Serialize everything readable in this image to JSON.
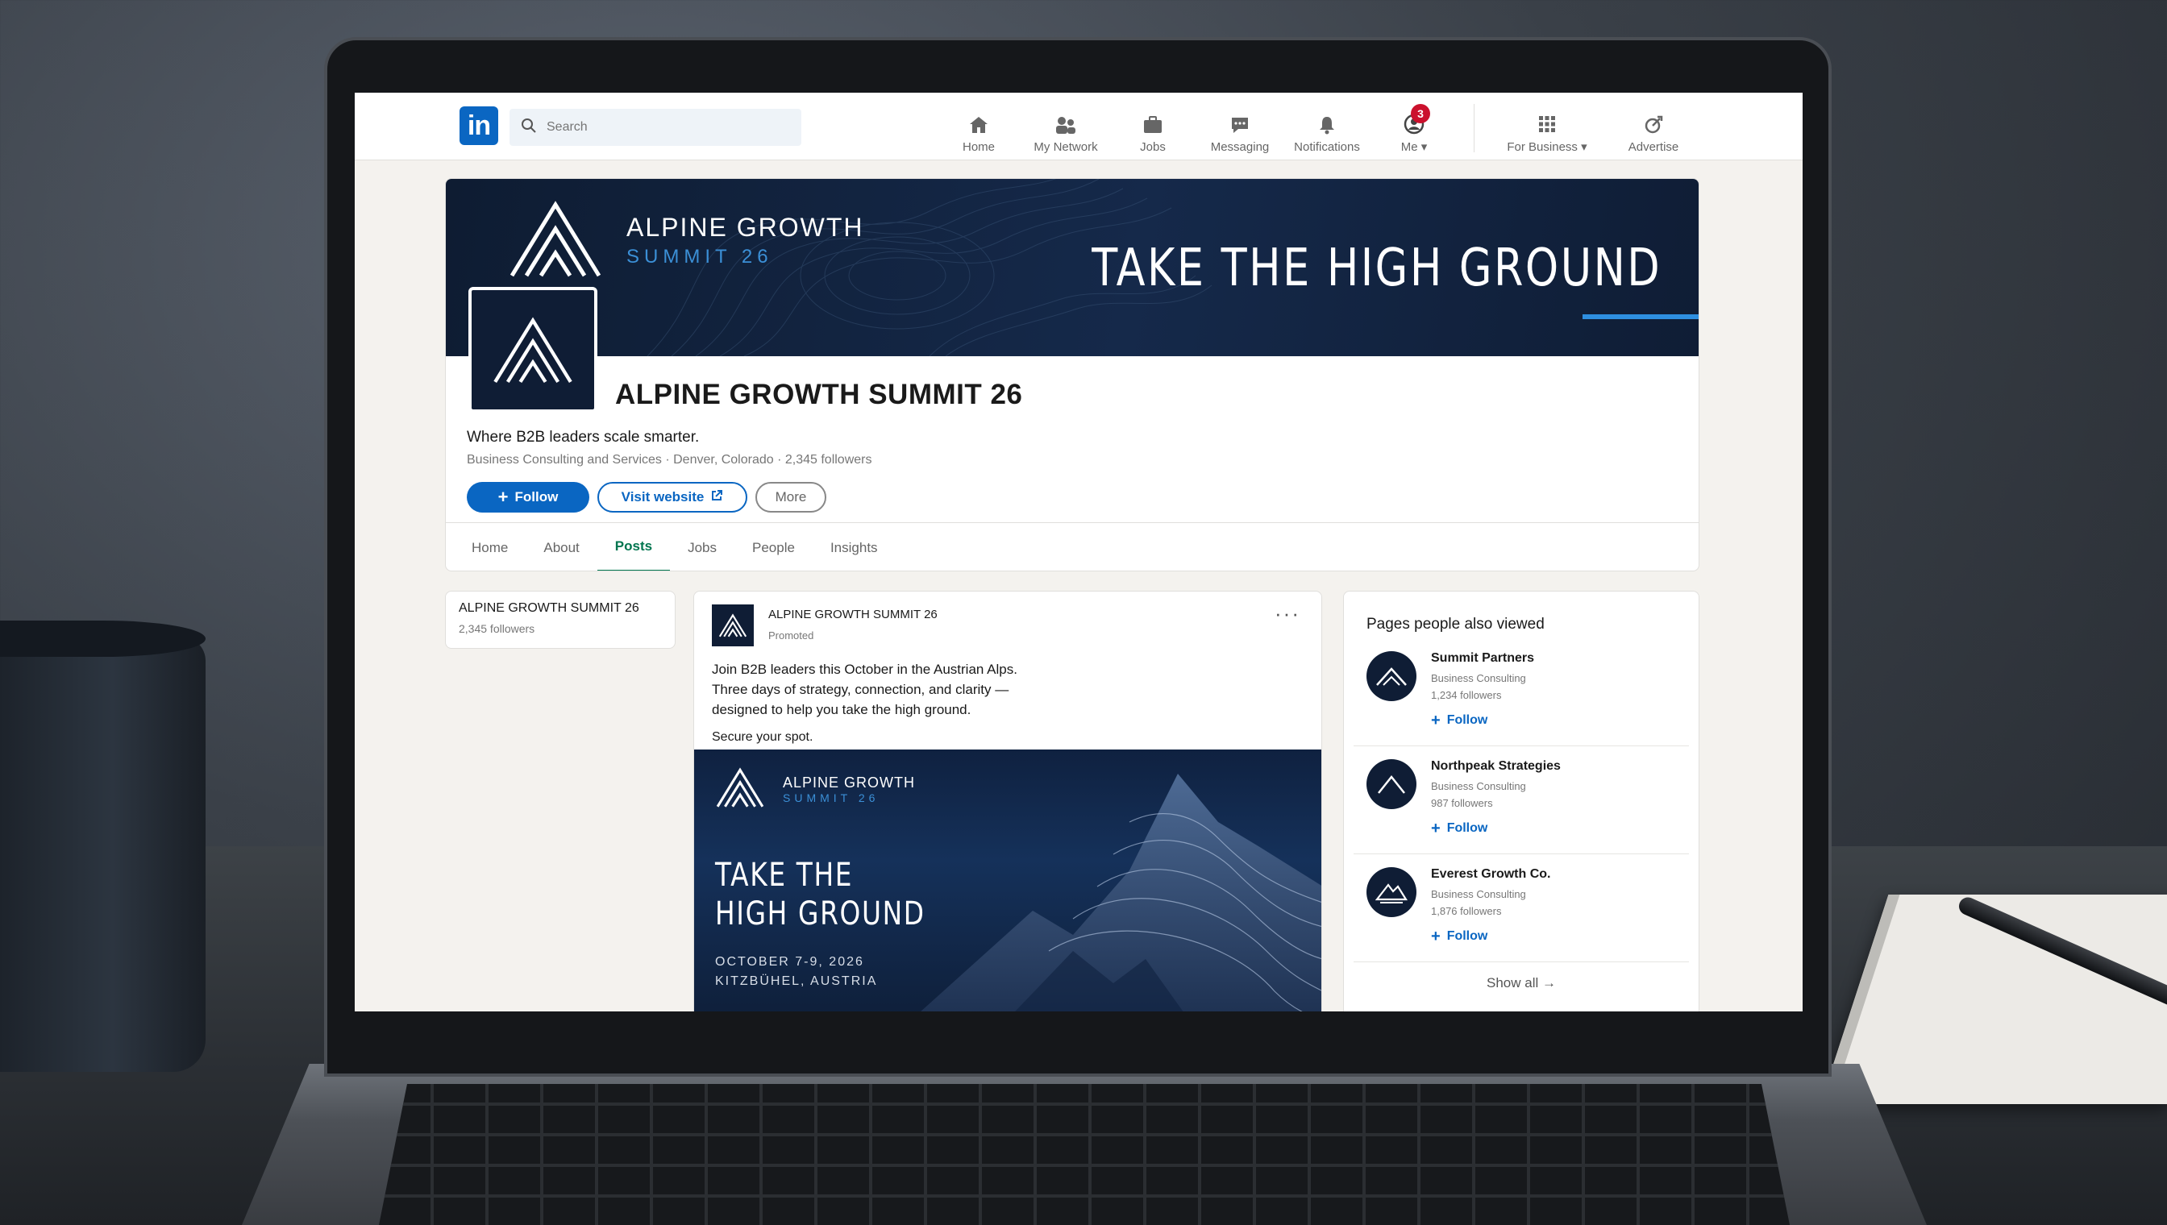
{
  "topnav": {
    "logo": "in",
    "search_placeholder": "Search",
    "items": [
      {
        "label": "Home",
        "icon": "home-icon"
      },
      {
        "label": "My Network",
        "icon": "network-icon"
      },
      {
        "label": "Jobs",
        "icon": "briefcase-icon"
      },
      {
        "label": "Messaging",
        "icon": "message-icon"
      },
      {
        "label": "Notifications",
        "icon": "bell-icon",
        "badge": "3"
      },
      {
        "label": "Me ▾",
        "icon": "avatar-icon"
      },
      {
        "label": "For Business ▾",
        "icon": "grid-icon"
      },
      {
        "label": "Advertise",
        "icon": "advertise-icon"
      }
    ]
  },
  "banner": {
    "brand_line1": "ALPINE GROWTH",
    "brand_line2": "SUMMIT 26",
    "tagline": "TAKE THE HIGH GROUND",
    "accent": "#2e8fe0"
  },
  "company": {
    "name": "ALPINE GROWTH SUMMIT 26",
    "tagline": "Where B2B leaders scale smarter.",
    "meta": "Business Consulting and Services · Denver, Colorado · 2,345 followers",
    "follow": "Follow",
    "visit": "Visit website",
    "more": "More",
    "tabs": [
      "Home",
      "About",
      "Posts",
      "Jobs",
      "People",
      "Insights"
    ],
    "active_tab": "Posts"
  },
  "left_card": {
    "name": "ALPINE GROWTH SUMMIT 26",
    "followers": "2,345 followers"
  },
  "post": {
    "author": "ALPINE GROWTH SUMMIT 26",
    "label": "Promoted",
    "more": "···",
    "text_lines": [
      "Join B2B leaders this October in the Austrian Alps.",
      "Three days of strategy, connection, and clarity —",
      "designed to help you take the high ground."
    ],
    "cta": "Secure your spot.",
    "image": {
      "brand_line1": "ALPINE GROWTH",
      "brand_line2": "SUMMIT 26",
      "tag_line1": "TAKE THE",
      "tag_line2": "HIGH GROUND",
      "date": "OCTOBER 7-9, 2026",
      "location": "KITZBÜHEL, AUSTRIA"
    }
  },
  "sidebar": {
    "title": "Pages people also viewed",
    "items": [
      {
        "name": "Summit Partners",
        "industry": "Business Consulting",
        "followers": "1,234 followers",
        "follow": "Follow"
      },
      {
        "name": "Northpeak Strategies",
        "industry": "Business Consulting",
        "followers": "987 followers",
        "follow": "Follow"
      },
      {
        "name": "Everest Growth Co.",
        "industry": "Business Consulting",
        "followers": "1,876 followers",
        "follow": "Follow"
      }
    ],
    "show_all": "Show all →"
  },
  "colors": {
    "brand_blue": "#0a66c2",
    "banner_navy": "#0f1d35",
    "active_tab": "#01754f",
    "badge_red": "#cb112d"
  }
}
